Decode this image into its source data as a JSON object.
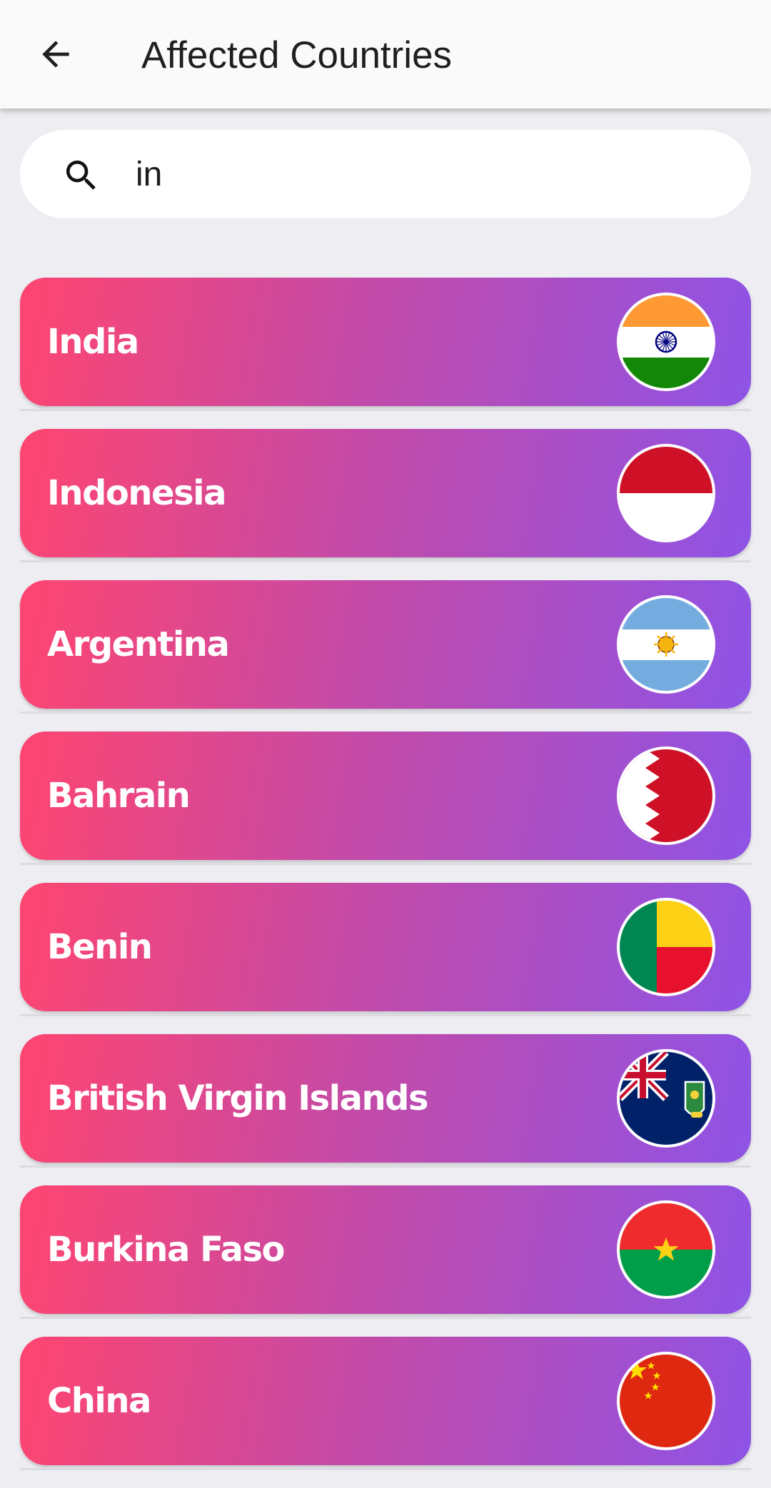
{
  "header": {
    "title": "Affected Countries",
    "back_icon": "arrow-back-icon"
  },
  "search": {
    "icon": "search-icon",
    "value": "in"
  },
  "countries": [
    {
      "name": "India",
      "flag_icon": "flag-india-icon"
    },
    {
      "name": "Indonesia",
      "flag_icon": "flag-indonesia-icon"
    },
    {
      "name": "Argentina",
      "flag_icon": "flag-argentina-icon"
    },
    {
      "name": "Bahrain",
      "flag_icon": "flag-bahrain-icon"
    },
    {
      "name": "Benin",
      "flag_icon": "flag-benin-icon"
    },
    {
      "name": "British Virgin Islands",
      "flag_icon": "flag-british-virgin-islands-icon"
    },
    {
      "name": "Burkina Faso",
      "flag_icon": "flag-burkina-faso-icon"
    },
    {
      "name": "China",
      "flag_icon": "flag-china-icon"
    }
  ],
  "colors": {
    "gradient_start": "#ff4570",
    "gradient_mid": "#c54aa6",
    "gradient_end": "#8e53e6",
    "background": "#ededf2"
  }
}
